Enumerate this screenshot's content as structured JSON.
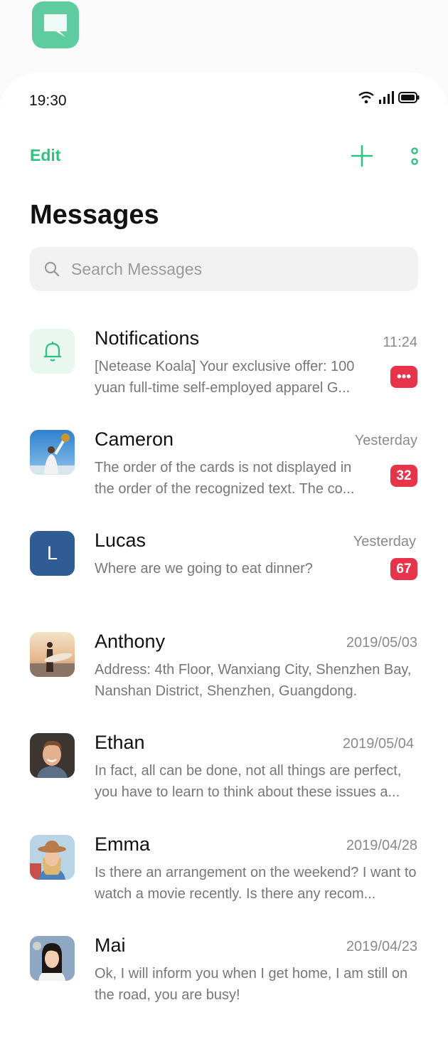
{
  "status": {
    "time": "19:30"
  },
  "header": {
    "edit_label": "Edit",
    "title": "Messages"
  },
  "search": {
    "placeholder": "Search Messages"
  },
  "colors": {
    "accent": "#2ec27e",
    "badge": "#e8344a",
    "app_icon": "#5fcba0"
  },
  "conversations": [
    {
      "name": "Notifications",
      "time": "11:24",
      "preview": "[Netease Koala] Your exclusive offer: 100 yuan full-time self-employed apparel G...",
      "badge": "•••",
      "avatar": "bell-icon"
    },
    {
      "name": "Cameron",
      "time": "Yesterday",
      "preview": "The order of the cards is not displayed in the order of the recognized text. The co...",
      "badge": "32",
      "avatar": "photo"
    },
    {
      "name": "Lucas",
      "time": "Yesterday",
      "preview": "Where are we going to eat dinner?",
      "badge": "67",
      "avatar": "L"
    },
    {
      "name": "Anthony",
      "time": "2019/05/03",
      "preview": "Address: 4th Floor, Wanxiang City, Shenzhen Bay, Nanshan District, Shenzhen, Guangdong.",
      "avatar": "photo"
    },
    {
      "name": "Ethan",
      "time": "2019/05/04",
      "preview": "In fact, all can be done, not all things are perfect, you have to learn to think about these issues a...",
      "avatar": "photo"
    },
    {
      "name": "Emma",
      "time": "2019/04/28",
      "preview": "Is there an arrangement on the weekend? I want to watch a movie recently. Is there any recom...",
      "avatar": "photo"
    },
    {
      "name": "Mai",
      "time": "2019/04/23",
      "preview": "Ok, I will inform you when I get home, I am still on the road, you are busy!",
      "avatar": "photo"
    }
  ]
}
